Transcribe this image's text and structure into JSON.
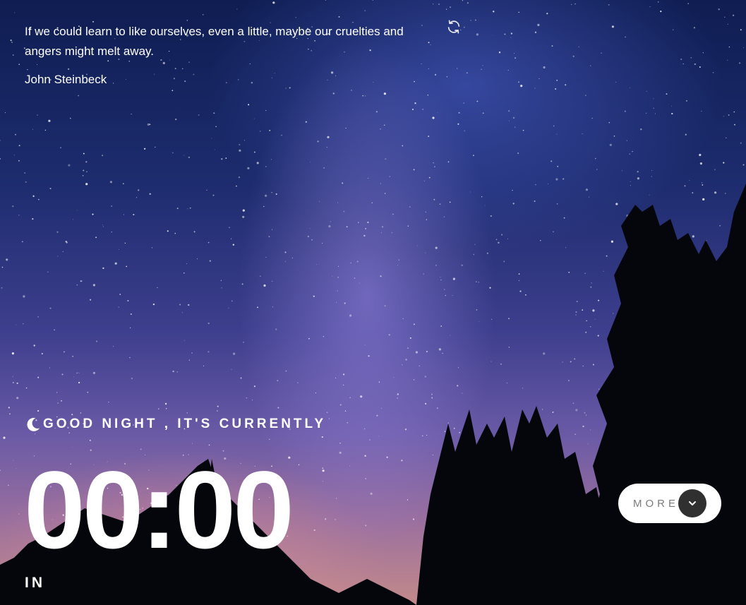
{
  "quote": {
    "text": "If we could learn to like ourselves, even a little, maybe our cruelties and angers might melt away.",
    "author": "John Steinbeck",
    "refresh_icon": "refresh-icon"
  },
  "greeting": {
    "icon": "moon-icon",
    "text": "GOOD NIGHT , IT'S CURRENTLY"
  },
  "clock": {
    "time": "00:00",
    "location": "IN"
  },
  "more_button": {
    "label": "MORE",
    "icon": "chevron-down-icon"
  },
  "colors": {
    "button_bg": "#ffffff",
    "button_text": "#7c7c7c",
    "chevron_bg": "#303030",
    "text": "#ffffff"
  }
}
